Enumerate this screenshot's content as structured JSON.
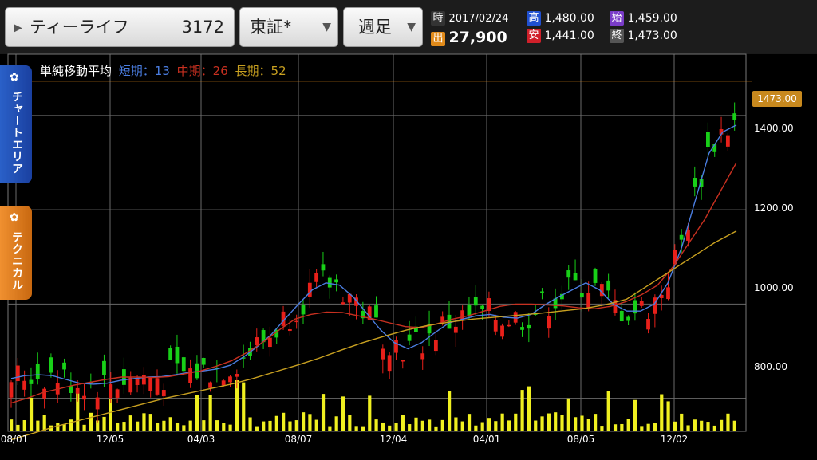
{
  "toolbar": {
    "stock_name": "ティーライフ",
    "stock_code": "3172",
    "market": "東証*",
    "period": "週足"
  },
  "quote": {
    "time_label": "時",
    "date": "2017/02/24",
    "volume_label": "出",
    "volume": "27,900",
    "high_label": "高",
    "high": "1,480.00",
    "low_label": "安",
    "low": "1,441.00",
    "open_label": "始",
    "open": "1,459.00",
    "close_label": "終",
    "close": "1,473.00"
  },
  "side_tabs": {
    "chart_area": "チャートエリア",
    "technical": "テクニカル"
  },
  "ma_legend": {
    "title": "単純移動平均",
    "short": "短期：13",
    "mid": "中期：26",
    "long": "長期：52"
  },
  "price_tag": "1473.00",
  "y_labels": [
    "1400.00",
    "1200.00",
    "1000.00",
    "800.00"
  ],
  "x_labels": [
    "08/01",
    "12/05",
    "04/03",
    "08/07",
    "12/04",
    "04/01",
    "08/05",
    "12/02"
  ],
  "colors": {
    "up": "#e8201a",
    "down": "#18d018",
    "short_ma": "#4a7de0",
    "mid_ma": "#c83020",
    "long_ma": "#c8a020",
    "volume": "#f0f020",
    "price_line": "#e08a1a",
    "tab_blue": "#1e50b0",
    "tab_orange": "#d87818"
  },
  "chart_data": {
    "type": "candlestick",
    "x_ticks": [
      "08/01",
      "12/05",
      "04/03",
      "08/07",
      "12/04",
      "04/01",
      "08/05",
      "12/02"
    ],
    "y_ticks": [
      1400,
      1200,
      1000,
      800
    ],
    "ylim": [
      730,
      1530
    ],
    "last_price": 1473,
    "series": [
      {
        "name": "短期：13",
        "values": [
          842,
          848,
          850,
          848,
          840,
          832,
          830,
          832,
          838,
          842,
          845,
          846,
          850,
          855,
          858,
          862,
          870,
          888,
          910,
          935,
          968,
          1000,
          1030,
          1045,
          1040,
          1015,
          980,
          945,
          918,
          905,
          918,
          940,
          960,
          968,
          975,
          978,
          972,
          970,
          978,
          998,
          1015,
          1030,
          1045,
          1030,
          1000,
          985,
          985,
          1000,
          1045,
          1120,
          1220,
          1320,
          1365,
          1380
        ]
      },
      {
        "name": "中期：26",
        "values": [
          790,
          800,
          812,
          820,
          828,
          834,
          840,
          845,
          845,
          844,
          846,
          852,
          858,
          868,
          880,
          898,
          920,
          945,
          968,
          978,
          983,
          982,
          975,
          968,
          960,
          952,
          950,
          958,
          968,
          975,
          985,
          995,
          1000,
          1000,
          998,
          996,
          992,
          990,
          995,
          1005,
          1020,
          1040,
          1080,
          1130,
          1180,
          1240,
          1300
        ]
      },
      {
        "name": "長期：52",
        "values": [
          712,
          726,
          740,
          752,
          764,
          776,
          788,
          800,
          810,
          820,
          830,
          842,
          856,
          870,
          885,
          902,
          918,
          932,
          945,
          955,
          962,
          968,
          972,
          976,
          980,
          985,
          990,
          998,
          1010,
          1040,
          1070,
          1100,
          1130,
          1155
        ]
      }
    ],
    "volume_scale": "relative"
  }
}
